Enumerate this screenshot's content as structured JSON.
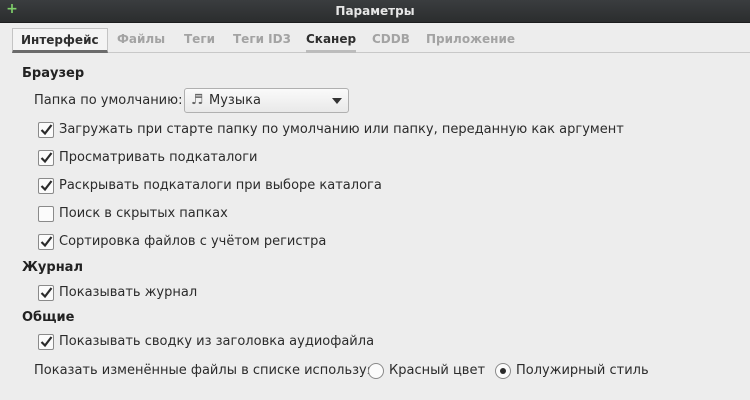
{
  "window": {
    "title": "Параметры"
  },
  "tabs": [
    {
      "label": "Интерфейс"
    },
    {
      "label": "Файлы"
    },
    {
      "label": "Теги"
    },
    {
      "label": "Теги ID3"
    },
    {
      "label": "Сканер"
    },
    {
      "label": "CDDB"
    },
    {
      "label": "Приложение"
    }
  ],
  "browser": {
    "title": "Браузер",
    "default_folder_label": "Папка по умолчанию:",
    "default_folder_value": "Музыка",
    "options": [
      {
        "label": "Загружать при старте папку по умолчанию или папку, переданную как аргумент",
        "checked": true
      },
      {
        "label": "Просматривать подкаталоги",
        "checked": true
      },
      {
        "label": "Раскрывать подкаталоги при выборе каталога",
        "checked": true
      },
      {
        "label": "Поиск в скрытых папках",
        "checked": false
      },
      {
        "label": "Сортировка файлов с учётом регистра",
        "checked": true
      }
    ]
  },
  "log": {
    "title": "Журнал",
    "options": [
      {
        "label": "Показывать журнал",
        "checked": true
      }
    ]
  },
  "general": {
    "title": "Общие",
    "options": [
      {
        "label": "Показывать сводку из заголовка аудиофайла",
        "checked": true
      }
    ],
    "changed_files_label": "Показать изменённые файлы в списке используя:",
    "radio": [
      {
        "label": "Красный цвет",
        "selected": false
      },
      {
        "label": "Полужирный стиль",
        "selected": true
      }
    ]
  },
  "colors": {
    "titlebar": "#2b2d2e",
    "background": "#ededed"
  },
  "icons": {
    "combo": "music-note-icon",
    "wm": "plus-icon"
  }
}
